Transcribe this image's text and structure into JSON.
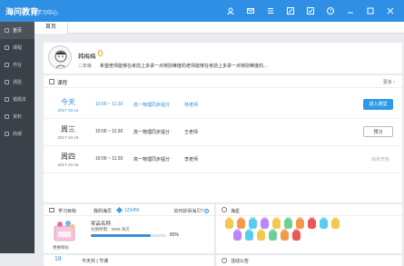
{
  "topbar": {
    "logo": "海问教育",
    "subtitle": "学习中心",
    "icons": [
      "user-icon",
      "mail-icon",
      "list-icon",
      "edit-icon",
      "check-icon",
      "help-icon",
      "minimize-icon",
      "maximize-icon",
      "close-icon"
    ]
  },
  "sidebar": {
    "items": [
      {
        "label": "首页",
        "active": true
      },
      {
        "label": "课程"
      },
      {
        "label": "作业"
      },
      {
        "label": "测验"
      },
      {
        "label": "错题本"
      },
      {
        "label": "资料"
      },
      {
        "label": "商城"
      }
    ]
  },
  "tabs": {
    "active": "首页"
  },
  "profile": {
    "name": "韩梅梅",
    "grade": "二年级",
    "message": "希望老师能够在考前上多讲一点特别难度的老师能够在考前上多讲一点特别难度的..."
  },
  "course": {
    "title": "课程",
    "more": "更多",
    "rows": [
      {
        "day": "今天",
        "date": "2017-10-11",
        "time": "10:00 ~ 11:30",
        "subject": "高一物理同步提分",
        "teacher": "林老师",
        "action": "进入课堂",
        "highlight": true
      },
      {
        "day": "周三",
        "date": "2017-10-15",
        "time": "10:00 ~ 11:30",
        "subject": "高一物理同步提分",
        "teacher": "王老师",
        "action": "预习"
      },
      {
        "day": "周四",
        "date": "2017-10-16",
        "time": "10:00 ~ 11:30",
        "subject": "高一物理同步提分",
        "teacher": "李老师",
        "action": "尚未开始"
      }
    ]
  },
  "goal": {
    "title": "学习目标",
    "sea_label": "我的海贝",
    "sea_value": "123456",
    "how": "如何获得海贝?",
    "prize_name": "奖品名称",
    "need": "兑换所需：9999 海贝",
    "progress": 80,
    "progress_text": "80%",
    "caption": "更换目标"
  },
  "stars": {
    "title": "海星",
    "row1": [
      "#f2c94c",
      "#f2994a",
      "#56ccf2",
      "#bb86fc",
      "#f2c94c",
      "#6fcf97",
      "#f2994a",
      "#eb5757",
      "#56ccf2",
      "#f2c94c"
    ],
    "row2": [
      "#bb86fc",
      "#56ccf2",
      "#f2c94c",
      "#6fcf97",
      "#f2994a",
      "#eb5757"
    ]
  },
  "bottom": {
    "count": "18",
    "today": "今天共 | 节课",
    "announce": "活动公告"
  }
}
